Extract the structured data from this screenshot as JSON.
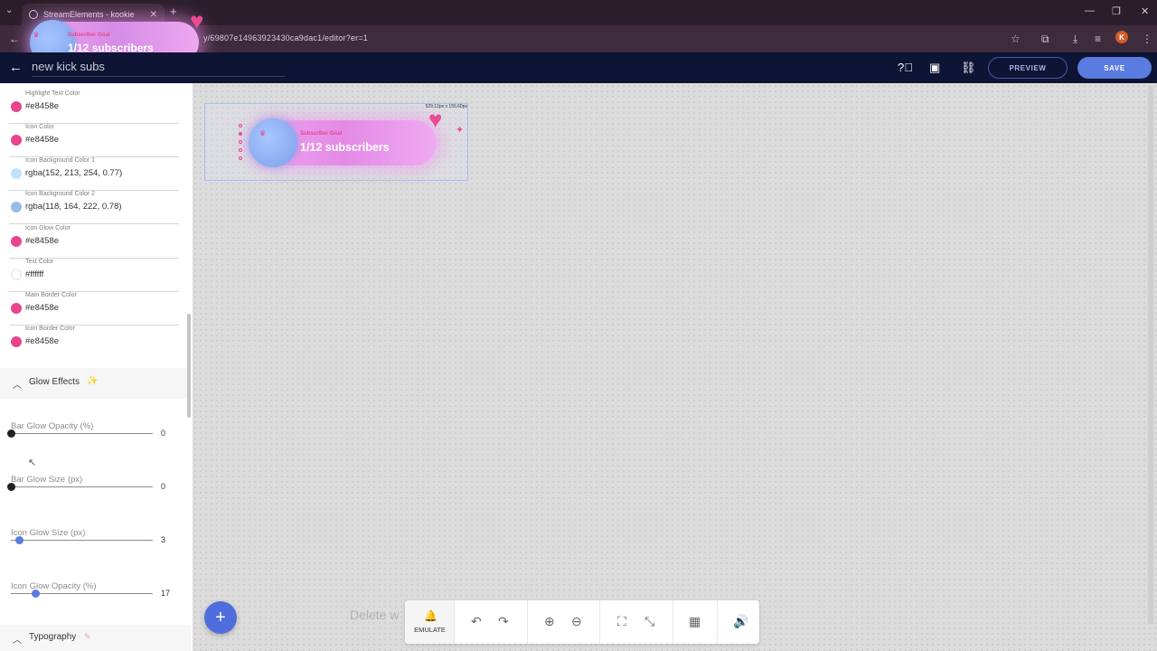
{
  "browser": {
    "tab_title": "StreamElements - kookie",
    "url": "y/69807e14963923430ca9dac1/editor?er=1",
    "profile_initial": "K"
  },
  "overlay_float": {
    "label": "Subscriber Goal",
    "value": "1/12 subscribers"
  },
  "header": {
    "title": "new kick subs",
    "preview_label": "PREVIEW",
    "save_label": "SAVE"
  },
  "colors": {
    "accent": "#e8458e",
    "header_bg": "#0e1433",
    "save_bg": "#5a7be0"
  },
  "color_fields": [
    {
      "label": "Highlight Text Color",
      "value": "#e8458e",
      "swatch": "#e8458e"
    },
    {
      "label": "Icon Color",
      "value": "#e8458e",
      "swatch": "#e8458e"
    },
    {
      "label": "Icon Background Color 1",
      "value": "rgba(152, 213, 254, 0.77)",
      "swatch": "#bfe3fb"
    },
    {
      "label": "Icon Background Color 2",
      "value": "rgba(118, 164, 222, 0.78)",
      "swatch": "#9bbbe6"
    },
    {
      "label": "Icon Glow Color",
      "value": "#e8458e",
      "swatch": "#e8458e"
    },
    {
      "label": "Text Color",
      "value": "#ffffff",
      "swatch": "#ffffff"
    },
    {
      "label": "Main Border Color",
      "value": "#e8458e",
      "swatch": "#e8458e"
    },
    {
      "label": "Icon Border Color",
      "value": "#e8458e",
      "swatch": "#e8458e"
    }
  ],
  "glow_section": {
    "title": "Glow Effects"
  },
  "sliders": [
    {
      "label": "Bar Glow Opacity (%)",
      "value": "0",
      "fraction": 0.0,
      "knob": "#222222"
    },
    {
      "label": "Bar Glow Size (px)",
      "value": "0",
      "fraction": 0.0,
      "knob": "#222222"
    },
    {
      "label": "Icon Glow Size (px)",
      "value": "3",
      "fraction": 0.06,
      "knob": "#5a7be0"
    },
    {
      "label": "Icon Glow Opacity (%)",
      "value": "17",
      "fraction": 0.17,
      "knob": "#5a7be0"
    }
  ],
  "typography_section": {
    "title": "Typography"
  },
  "canvas": {
    "widget_dims": "529.12px x 155.60px",
    "widget_label": "Subscriber Goal",
    "widget_value": "1/12 subscribers",
    "delete_hint": "Delete w"
  },
  "toolbar": {
    "emulate_label": "EMULATE"
  }
}
